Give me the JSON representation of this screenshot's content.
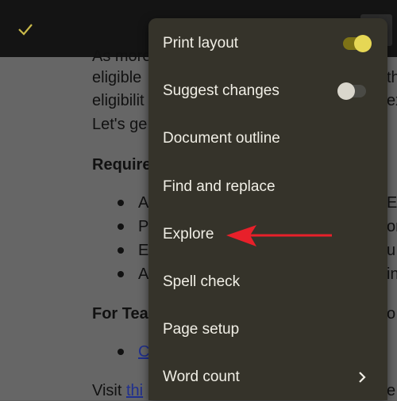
{
  "menu": {
    "items": [
      {
        "label": "Print layout",
        "toggle": "on"
      },
      {
        "label": "Suggest changes",
        "toggle": "off"
      },
      {
        "label": "Document outline"
      },
      {
        "label": "Find and replace"
      },
      {
        "label": "Explore"
      },
      {
        "label": "Spell check"
      },
      {
        "label": "Page setup"
      },
      {
        "label": "Word count"
      }
    ]
  },
  "document": {
    "lines": [
      "As more",
      "eligible",
      "eligibilit",
      "Let's ge"
    ],
    "heading_req": "Require",
    "bullets": [
      "A",
      "P",
      "E",
      "A"
    ],
    "heading_teams": "For Tea",
    "link_bullet": "C",
    "visit": "Visit ",
    "visit_link": "thi",
    "right_fragments": [
      "th",
      "ex",
      "E",
      "on",
      "u",
      "in",
      "o",
      "e"
    ]
  },
  "colors": {
    "accent": "#e6d755",
    "annotation_arrow": "#e8202a",
    "menu_bg": "#35332a"
  }
}
